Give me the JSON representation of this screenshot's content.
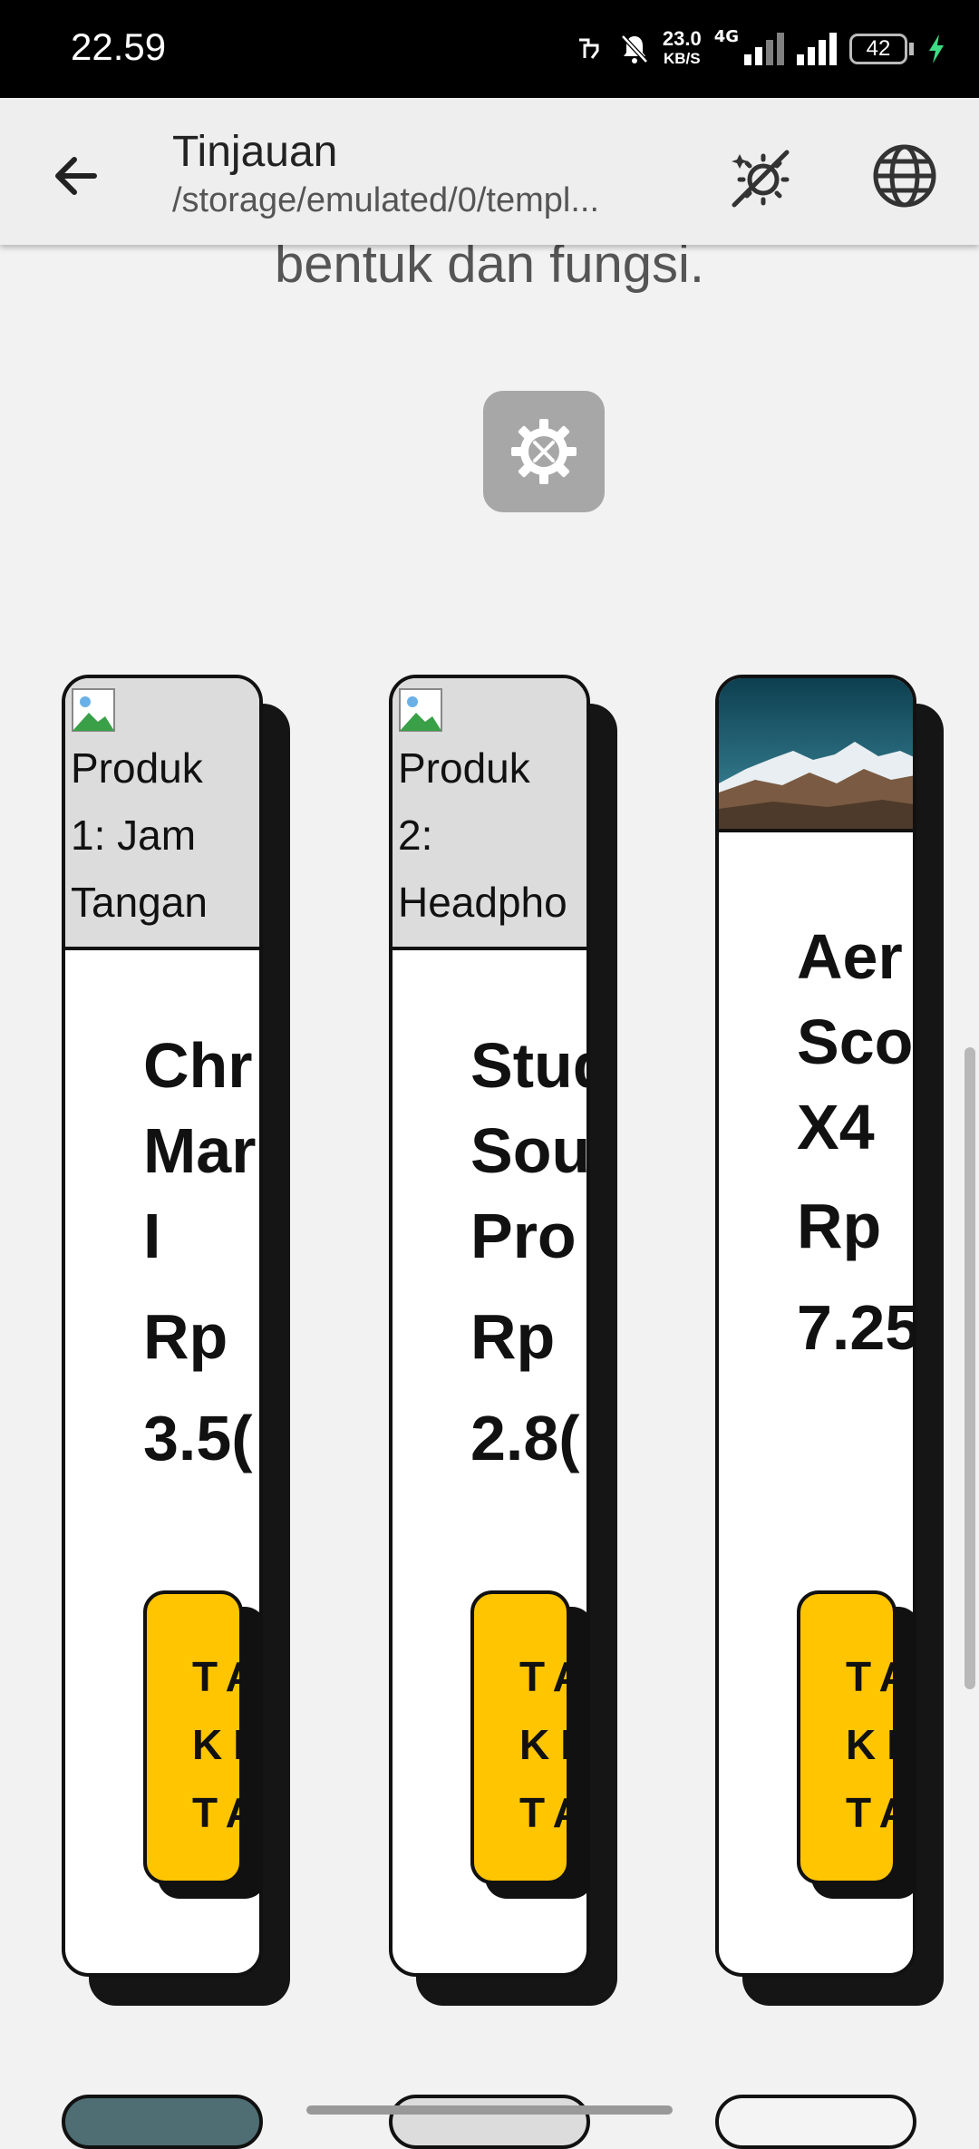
{
  "status_bar": {
    "time": "22.59",
    "net_speed": "23.0",
    "net_speed_unit": "KB/S",
    "network_type": "4G",
    "battery": "42"
  },
  "app_bar": {
    "title": "Tinjauan",
    "subtitle": "/storage/emulated/0/templ..."
  },
  "content": {
    "tagline": "bentuk dan fungsi.",
    "products": [
      {
        "image_alt": [
          "Produk",
          "1: Jam",
          "Tangan"
        ],
        "name": [
          "Chr",
          "Mar",
          "I"
        ],
        "price": [
          "Rp",
          "3.5("
        ],
        "button": [
          "TA",
          "KE",
          "TA"
        ]
      },
      {
        "image_alt": [
          "Produk",
          "2:",
          "Headpho"
        ],
        "name": [
          "Stud",
          "Sou",
          "Pro"
        ],
        "price": [
          "Rp",
          "2.8("
        ],
        "button": [
          "TA",
          "KE",
          "TA"
        ]
      },
      {
        "image_alt": [],
        "name": [
          "Aer",
          "Sco",
          "X4"
        ],
        "price": [
          "Rp",
          "7.25"
        ],
        "button": [
          "TA",
          "KE",
          "TA"
        ]
      }
    ]
  },
  "colors": {
    "accent": "#ffc500",
    "card_border": "#111111",
    "page_background": "#f2f2f2"
  }
}
